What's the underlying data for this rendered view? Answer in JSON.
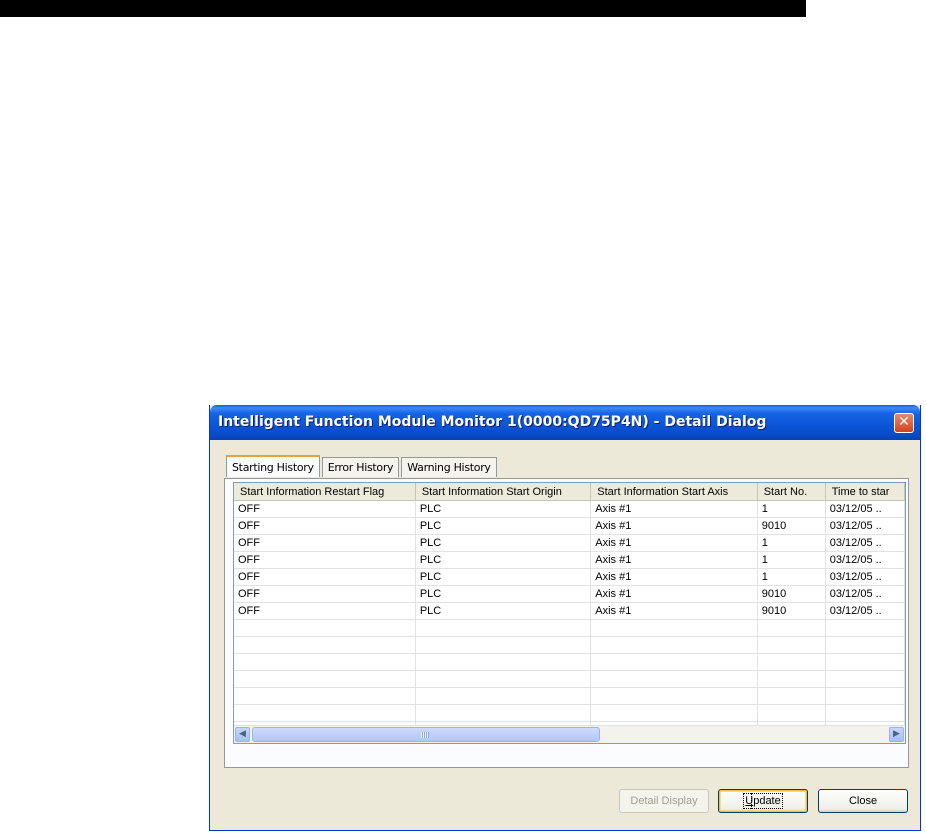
{
  "window": {
    "title": "Intelligent Function Module Monitor 1(0000:QD75P4N) - Detail Dialog",
    "close_glyph": "✕"
  },
  "tabs": [
    {
      "label": "Starting History",
      "active": true
    },
    {
      "label": "Error History",
      "active": false
    },
    {
      "label": "Warning History",
      "active": false
    }
  ],
  "table": {
    "columns": [
      "Start Information Restart Flag",
      "Start Information Start Origin",
      "Start Information Start Axis",
      "Start No.",
      "Time to star"
    ],
    "rows": [
      [
        "OFF",
        "PLC",
        "Axis #1",
        "1",
        "03/12/05 .."
      ],
      [
        "OFF",
        "PLC",
        "Axis #1",
        "9010",
        "03/12/05 .."
      ],
      [
        "OFF",
        "PLC",
        "Axis #1",
        "1",
        "03/12/05 .."
      ],
      [
        "OFF",
        "PLC",
        "Axis #1",
        "1",
        "03/12/05 .."
      ],
      [
        "OFF",
        "PLC",
        "Axis #1",
        "1",
        "03/12/05 .."
      ],
      [
        "OFF",
        "PLC",
        "Axis #1",
        "9010",
        "03/12/05 .."
      ],
      [
        "OFF",
        "PLC",
        "Axis #1",
        "9010",
        "03/12/05 .."
      ]
    ],
    "empty_rows": 8
  },
  "scrollbar": {
    "left_arrow": "◀",
    "right_arrow": "▶"
  },
  "buttons": {
    "detail_display": "Detail Display",
    "update_accel": "U",
    "update_rest": "pdate",
    "close": "Close"
  }
}
